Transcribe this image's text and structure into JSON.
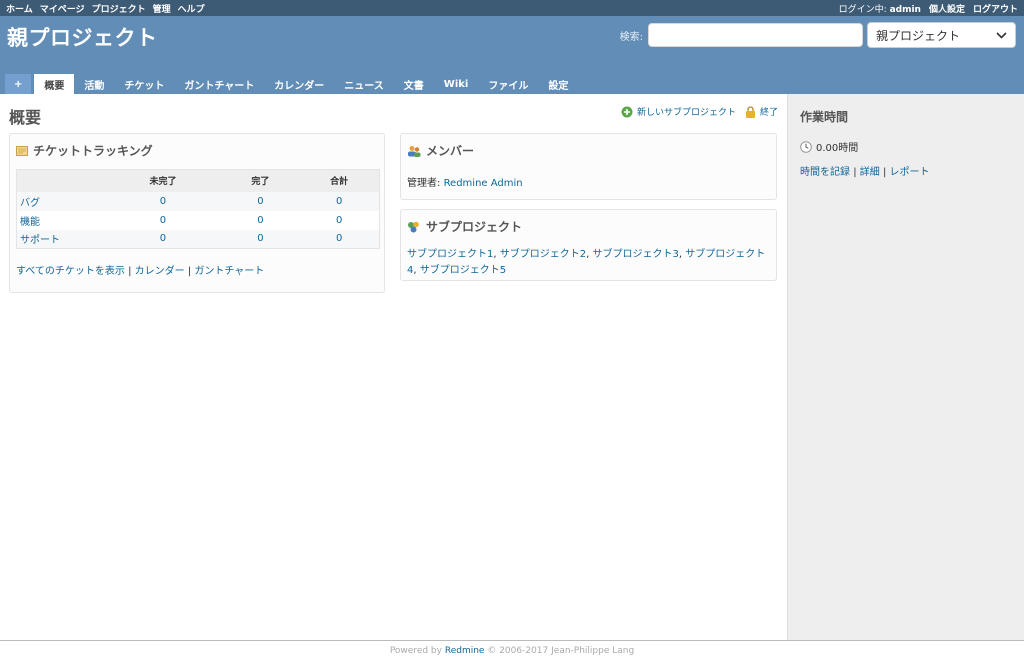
{
  "top_menu": {
    "items": [
      "ホーム",
      "マイページ",
      "プロジェクト",
      "管理",
      "ヘルプ"
    ],
    "logged_in_label": "ログイン中:",
    "user": "admin",
    "my_account": "個人設定",
    "logout": "ログアウト"
  },
  "header": {
    "title": "親プロジェクト",
    "search_label": "検索:",
    "search_value": "",
    "project_select": "親プロジェクト"
  },
  "tabs": [
    {
      "label": "+"
    },
    {
      "label": "概要"
    },
    {
      "label": "活動"
    },
    {
      "label": "チケット"
    },
    {
      "label": "ガントチャート"
    },
    {
      "label": "カレンダー"
    },
    {
      "label": "ニュース"
    },
    {
      "label": "文書"
    },
    {
      "label": "Wiki"
    },
    {
      "label": "ファイル"
    },
    {
      "label": "設定"
    }
  ],
  "content": {
    "title": "概要",
    "new_subproject": "新しいサブプロジェクト",
    "close": "終了"
  },
  "issues": {
    "title": "チケットトラッキング",
    "headers": [
      "",
      "未完了",
      "完了",
      "合計"
    ],
    "rows": [
      {
        "name": "バグ",
        "open": "0",
        "closed": "0",
        "total": "0"
      },
      {
        "name": "機能",
        "open": "0",
        "closed": "0",
        "total": "0"
      },
      {
        "name": "サポート",
        "open": "0",
        "closed": "0",
        "total": "0"
      }
    ],
    "link_all": "すべてのチケットを表示",
    "link_calendar": "カレンダー",
    "link_gantt": "ガントチャート",
    "sep": "|"
  },
  "members": {
    "title": "メンバー",
    "role": "管理者:",
    "name": "Redmine Admin"
  },
  "subprojects": {
    "title": "サブプロジェクト",
    "items": [
      "サブプロジェクト1",
      "サブプロジェクト2",
      "サブプロジェクト3",
      "サブプロジェクト4",
      "サブプロジェクト5"
    ]
  },
  "sidebar": {
    "title": "作業時間",
    "hours": "0.00時間",
    "log_time": "時間を記録",
    "details": "詳細",
    "report": "レポート",
    "sep": "|"
  },
  "footer": {
    "powered_by": "Powered by",
    "redmine": "Redmine",
    "copyright": "© 2006-2017 Jean-Philippe Lang"
  },
  "colors": {
    "top_menu_bg": "#3E5B76",
    "header_bg": "#628DB6",
    "link": "#169",
    "sidebar_bg": "#EEEEEE"
  }
}
